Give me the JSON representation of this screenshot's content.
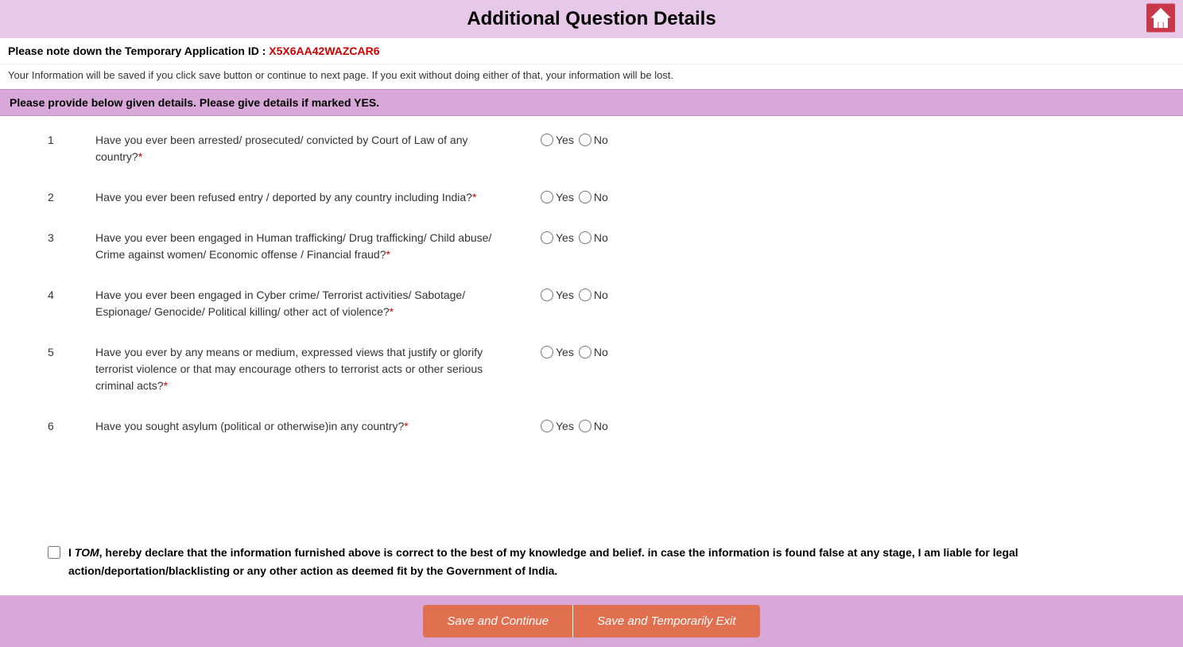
{
  "header": {
    "title": "Additional Question Details",
    "home_icon": "home-icon"
  },
  "app_id": {
    "label": "Please note down the Temporary Application ID :",
    "value": "X5X6AA42WAZCAR6"
  },
  "info_text": "Your Information will be saved if you click save button or continue to next page. If you exit without doing either of that, your information will be lost.",
  "instruction": "Please provide below given details. Please give details if marked YES.",
  "questions": [
    {
      "num": "1",
      "text": "Have you ever been arrested/ prosecuted/ convicted by Court of Law of any country?",
      "required": true
    },
    {
      "num": "2",
      "text": "Have you ever been refused entry / deported by any country including India?",
      "required": true
    },
    {
      "num": "3",
      "text": "Have you ever been engaged in Human trafficking/ Drug trafficking/ Child abuse/ Crime against women/ Economic offense / Financial fraud?",
      "required": true
    },
    {
      "num": "4",
      "text": "Have you ever been engaged in Cyber crime/ Terrorist activities/ Sabotage/ Espionage/ Genocide/ Political killing/ other act of violence?",
      "required": true
    },
    {
      "num": "5",
      "text": "Have you ever by any means or medium, expressed views that justify or glorify terrorist violence or that may encourage others to terrorist acts or other serious criminal acts?",
      "required": true
    },
    {
      "num": "6",
      "text": "Have you sought asylum (political or otherwise)in any country?",
      "required": true
    }
  ],
  "radio_options": {
    "yes": "Yes",
    "no": "No"
  },
  "declaration": {
    "name": "TOM",
    "text_before": "I ",
    "text_after": ", hereby declare that the information furnished above is correct to the best of my knowledge and belief. in case the information is found false at any stage, I am liable for legal action/deportation/blacklisting or any other action as deemed fit by the Government of India."
  },
  "buttons": {
    "save_continue": "Save and Continue",
    "save_exit": "Save and Temporarily Exit"
  }
}
